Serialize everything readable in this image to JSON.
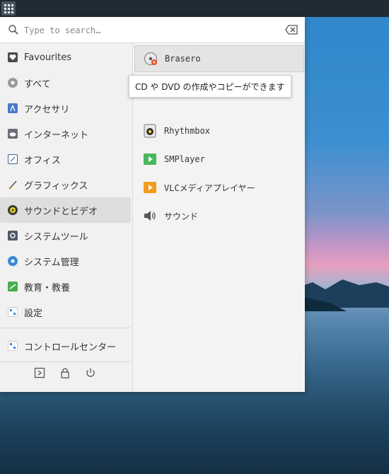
{
  "search": {
    "placeholder": "Type to search…",
    "value": ""
  },
  "categories": [
    {
      "label": "Favourites",
      "icon": "heart-icon"
    },
    {
      "label": "すべて",
      "icon": "all-icon"
    },
    {
      "label": "アクセサリ",
      "icon": "accessories-icon"
    },
    {
      "label": "インターネット",
      "icon": "internet-icon"
    },
    {
      "label": "オフィス",
      "icon": "office-icon"
    },
    {
      "label": "グラフィックス",
      "icon": "graphics-icon"
    },
    {
      "label": "サウンドとビデオ",
      "icon": "multimedia-icon",
      "active": true
    },
    {
      "label": "システムツール",
      "icon": "system-tools-icon"
    },
    {
      "label": "システム管理",
      "icon": "administration-icon"
    },
    {
      "label": "教育・教養",
      "icon": "education-icon"
    },
    {
      "label": "設定",
      "icon": "settings-icon"
    }
  ],
  "control_center": {
    "label": "コントロールセンター",
    "icon": "control-center-icon"
  },
  "apps": [
    {
      "label": "Brasero",
      "icon": "brasero-icon",
      "hover": true
    },
    {
      "label": "",
      "icon": ""
    },
    {
      "label": "Rhythmbox",
      "icon": "rhythmbox-icon"
    },
    {
      "label": "SMPlayer",
      "icon": "smplayer-icon"
    },
    {
      "label": "VLCメディアプレイヤー",
      "icon": "vlc-icon"
    },
    {
      "label": "サウンド",
      "icon": "sound-icon"
    }
  ],
  "tooltip": {
    "text": "CD や DVD の作成やコピーができます"
  },
  "colors": {
    "accent_active": "#dedede",
    "panel": "#f3f3f3",
    "taskbar": "#1f2b35"
  }
}
